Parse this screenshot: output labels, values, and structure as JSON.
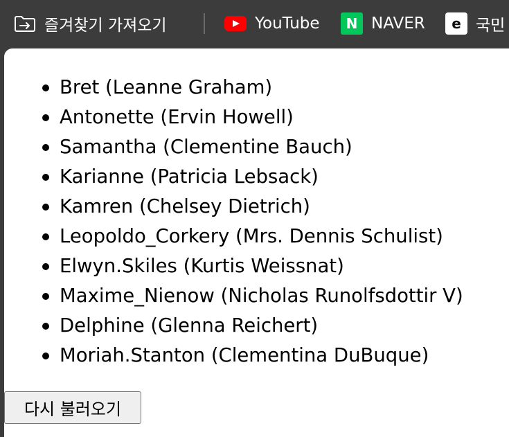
{
  "bookmarks_bar": {
    "items": [
      {
        "label": "즐겨찾기 가져오기",
        "icon": "import-favorites-icon"
      },
      {
        "label": "YouTube",
        "icon": "youtube-icon",
        "color": "#ff0000"
      },
      {
        "label": "NAVER",
        "icon": "naver-icon",
        "icon_text": "N",
        "color": "#03c75a"
      },
      {
        "label": "국민",
        "icon": "kookmin-ecampus-icon",
        "icon_text": "e"
      }
    ]
  },
  "users": [
    {
      "username": "Bret",
      "name": "Leanne Graham",
      "display": "Bret (Leanne Graham)"
    },
    {
      "username": "Antonette",
      "name": "Ervin Howell",
      "display": "Antonette (Ervin Howell)"
    },
    {
      "username": "Samantha",
      "name": "Clementine Bauch",
      "display": "Samantha (Clementine Bauch)"
    },
    {
      "username": "Karianne",
      "name": "Patricia Lebsack",
      "display": "Karianne (Patricia Lebsack)"
    },
    {
      "username": "Kamren",
      "name": "Chelsey Dietrich",
      "display": "Kamren (Chelsey Dietrich)"
    },
    {
      "username": "Leopoldo_Corkery",
      "name": "Mrs. Dennis Schulist",
      "display": "Leopoldo_Corkery (Mrs. Dennis Schulist)"
    },
    {
      "username": "Elwyn.Skiles",
      "name": "Kurtis Weissnat",
      "display": "Elwyn.Skiles (Kurtis Weissnat)"
    },
    {
      "username": "Maxime_Nienow",
      "name": "Nicholas Runolfsdottir V",
      "display": "Maxime_Nienow (Nicholas Runolfsdottir V)"
    },
    {
      "username": "Delphine",
      "name": "Glenna Reichert",
      "display": "Delphine (Glenna Reichert)"
    },
    {
      "username": "Moriah.Stanton",
      "name": "Clementina DuBuque",
      "display": "Moriah.Stanton (Clementina DuBuque)"
    }
  ],
  "reload_button": {
    "label": "다시 불러오기"
  },
  "colors": {
    "bar_background": "#3c3c3c",
    "page_background": "#ffffff",
    "button_background": "#efefef",
    "button_border": "#767676"
  }
}
